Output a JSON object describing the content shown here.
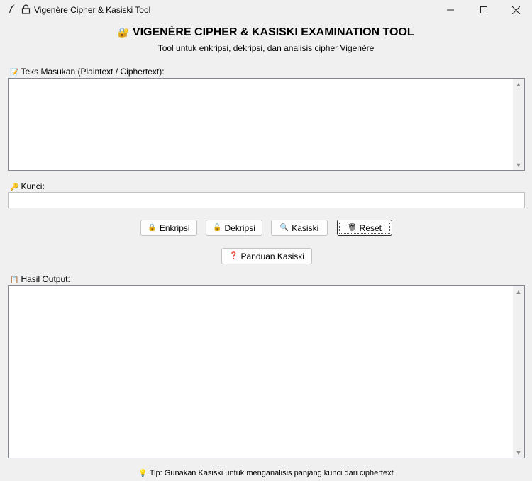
{
  "window": {
    "title": "Vigenère Cipher & Kasiski Tool",
    "app_icon": "feather-icon",
    "title_icon": "lock-icon",
    "minimize_glyph": "—",
    "maximize_glyph": "☐",
    "close_glyph": "✕"
  },
  "header": {
    "title_icon": "🔐",
    "title": "VIGENÈRE CIPHER & KASISKI EXAMINATION TOOL",
    "subtitle": "Tool untuk enkripsi, dekripsi, dan analisis cipher Vigenère"
  },
  "input": {
    "label_icon": "📝",
    "label": "Teks Masukan (Plaintext / Ciphertext):",
    "value": ""
  },
  "key": {
    "label_icon": "🔑",
    "label": "Kunci:",
    "value": ""
  },
  "buttons": {
    "encrypt": {
      "icon": "🔒",
      "label": "Enkripsi"
    },
    "decrypt": {
      "icon": "🔓",
      "label": "Dekripsi"
    },
    "kasiski": {
      "icon": "🔍",
      "label": "Kasiski"
    },
    "reset": {
      "icon": "🗑",
      "label": "Reset"
    },
    "guide": {
      "icon": "❓",
      "label": "Panduan Kasiski"
    }
  },
  "output": {
    "label_icon": "📋",
    "label": "Hasil Output:",
    "value": ""
  },
  "tip": {
    "icon": "💡",
    "text": "Tip: Gunakan Kasiski untuk menganalisis panjang kunci dari ciphertext"
  }
}
